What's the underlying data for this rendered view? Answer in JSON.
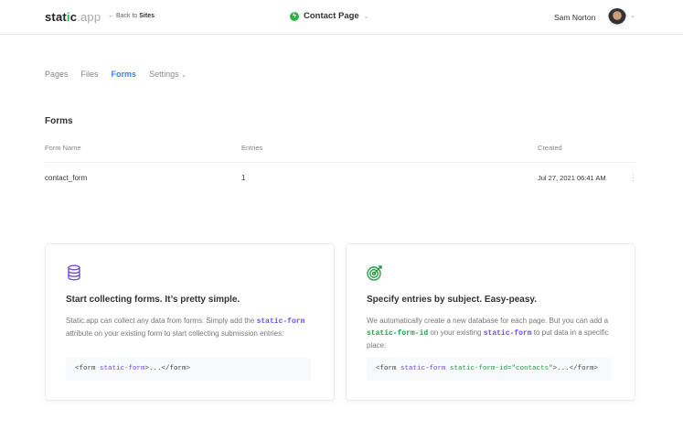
{
  "header": {
    "logo_a": "stat",
    "logo_i": "i",
    "logo_b": "c",
    "logo_app": ".app",
    "back_prefix": "← Back to",
    "back_link": "Sites",
    "site_name": "Contact Page",
    "site_icon": "lightning-icon",
    "user_name": "Sam Norton"
  },
  "tabs": [
    {
      "label": "Pages"
    },
    {
      "label": "Files"
    },
    {
      "label": "Forms",
      "active": true
    },
    {
      "label": "Settings"
    }
  ],
  "forms": {
    "title": "Forms",
    "columns": [
      "Form Name",
      "Entries",
      "Created"
    ],
    "rows": [
      {
        "name": "contact_form",
        "entries": "1",
        "created": "Jul 27, 2021 06:41 AM"
      }
    ]
  },
  "cards": [
    {
      "icon": "database-icon",
      "title": "Start collecting forms. It’s pretty simple.",
      "text1": "Static.app can collect any data from forms. Simply add the",
      "kw1": "static-form",
      "text2": "attribute on your existing form to start collecting submission entries:",
      "code": {
        "a": "<form ",
        "b": "static-form",
        "c": ">...</form>"
      }
    },
    {
      "icon": "target-icon",
      "title": "Specify entries by subject. Easy-peasy.",
      "text1": "We automatically create a new database for each page. But you can add a",
      "kw1": "static-form-id",
      "text2": "on your existing",
      "kw2": "static-form",
      "text3": "to put data in a specific place:",
      "code": {
        "a": "<form ",
        "b": "static-form",
        "c": "static-form-id=\"contacts\"",
        "d": ">...</form>"
      }
    }
  ],
  "colors": {
    "accent": "#3b82f6",
    "green": "#2db34a",
    "purple": "#6d4fe0"
  }
}
